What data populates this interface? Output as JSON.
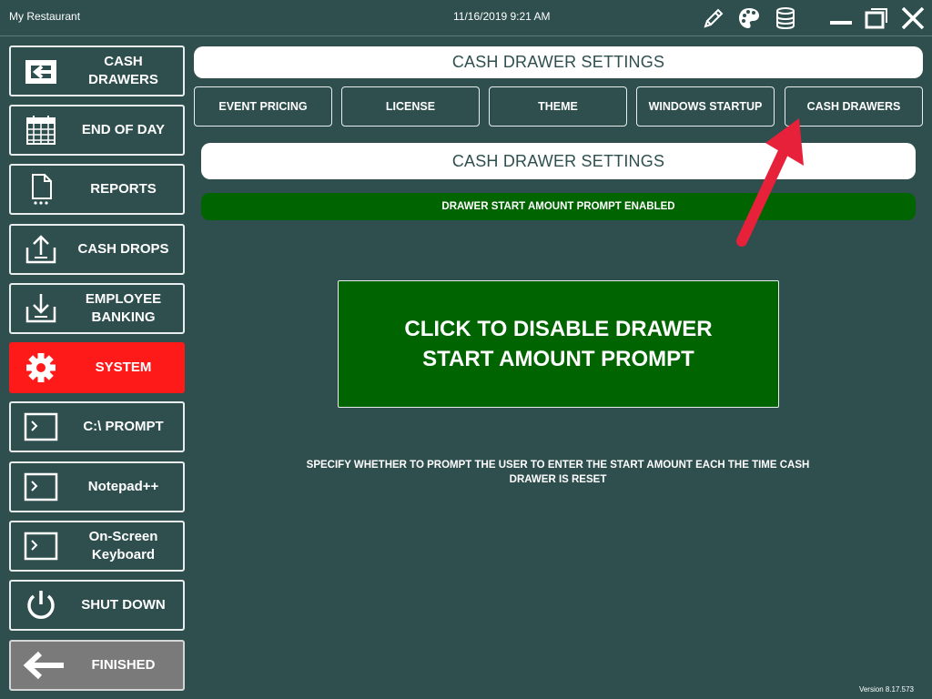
{
  "titlebar": {
    "app_title": "My Restaurant",
    "datetime": "11/16/2019 9:21 AM",
    "icons": [
      "pencil-icon",
      "palette-icon",
      "database-icon",
      "minimize-icon",
      "restore-icon",
      "close-icon"
    ]
  },
  "sidebar": {
    "items": [
      {
        "label": "CASH\nDRAWERS",
        "icon": "cash-drawer-icon"
      },
      {
        "label": "END OF DAY",
        "icon": "calendar-icon"
      },
      {
        "label": "REPORTS",
        "icon": "report-icon"
      },
      {
        "label": "CASH DROPS",
        "icon": "upload-tray-icon"
      },
      {
        "label": "EMPLOYEE\nBANKING",
        "icon": "download-tray-icon"
      },
      {
        "label": "SYSTEM",
        "icon": "gear-icon",
        "active": true
      },
      {
        "label": "C:\\ PROMPT",
        "icon": "terminal-icon"
      },
      {
        "label": "Notepad++",
        "icon": "terminal-icon"
      },
      {
        "label": "On-Screen\nKeyboard",
        "icon": "terminal-icon"
      },
      {
        "label": "SHUT DOWN",
        "icon": "power-icon"
      },
      {
        "label": "FINISHED",
        "icon": "back-arrow-icon"
      }
    ]
  },
  "main": {
    "header_title": "CASH DRAWER SETTINGS",
    "tabs": [
      {
        "label": "EVENT PRICING"
      },
      {
        "label": "LICENSE"
      },
      {
        "label": "THEME"
      },
      {
        "label": "WINDOWS STARTUP"
      },
      {
        "label": "CASH DRAWERS"
      }
    ],
    "section_title": "CASH DRAWER SETTINGS",
    "status_text": "DRAWER START AMOUNT PROMPT ENABLED",
    "toggle_button_label": "CLICK TO DISABLE DRAWER START AMOUNT PROMPT",
    "description": "SPECIFY WHETHER TO PROMPT THE USER TO ENTER THE START AMOUNT EACH THE TIME CASH DRAWER IS RESET"
  },
  "version": "Version 8.17.573",
  "colors": {
    "background": "#2f4f4f",
    "active": "#ff1a1a",
    "status_green": "#006400",
    "finished_gray": "#7a7a7a",
    "annotation_arrow": "#e8213a"
  }
}
